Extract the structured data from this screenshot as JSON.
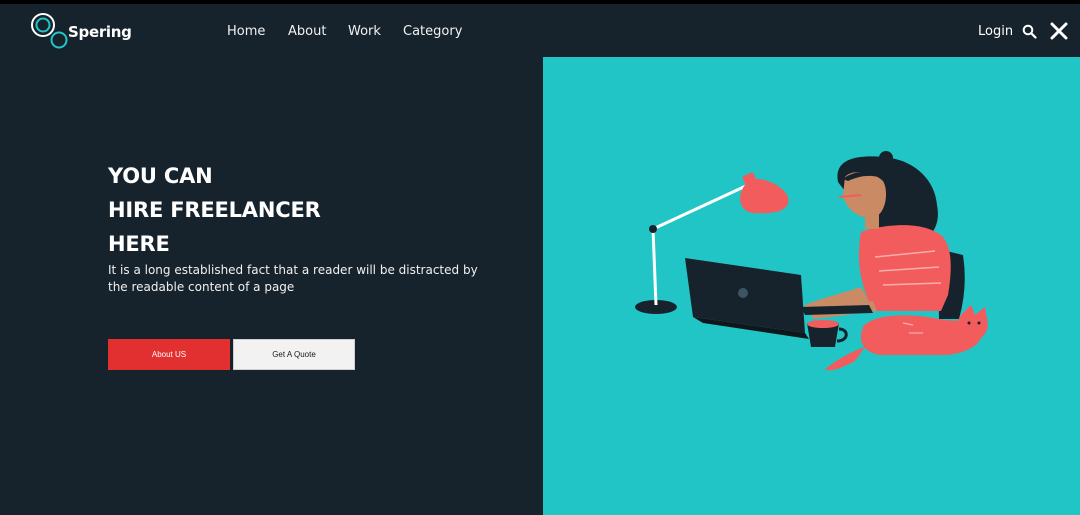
{
  "brand": {
    "name": "Spering"
  },
  "nav": {
    "items": [
      "Home",
      "About",
      "Work",
      "Category"
    ],
    "login_label": "Login"
  },
  "icons": {
    "search": "search-icon",
    "close": "close-icon",
    "logo": "rings-logo-icon"
  },
  "hero": {
    "headline_lines": [
      "YOU CAN",
      "HIRE FREELANCER",
      "HERE"
    ],
    "description": "It is a long established fact that a reader will be distracted by the readable content of a page",
    "primary_button": "About US",
    "secondary_button": "Get A Quote"
  },
  "colors": {
    "background": "#17232c",
    "accent_panel": "#22c5c6",
    "primary_button": "#e22f2f",
    "illustration_coral": "#f25c5c"
  }
}
